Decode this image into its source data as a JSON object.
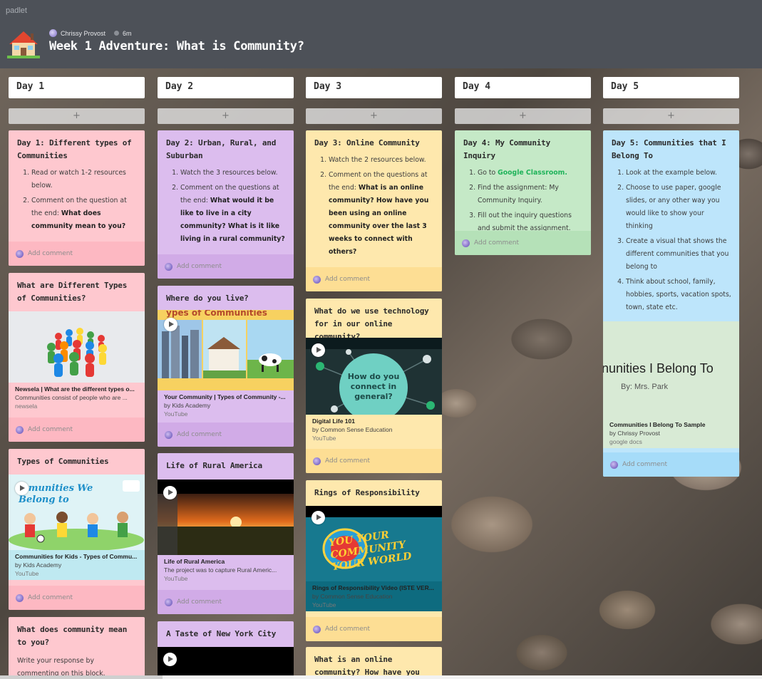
{
  "app": {
    "brand": "padlet"
  },
  "header": {
    "author": "Chrissy Provost",
    "time": "6m",
    "title": "Week 1 Adventure: What is Community?"
  },
  "add_symbol": "+",
  "comment_label": "Add comment",
  "columns": [
    {
      "label": "Day 1",
      "cards": [
        {
          "title": "Day 1: Different types of Communities",
          "items": [
            "Read or watch 1-2 resources below.",
            "Comment on the question at the end: ",
            "What does community mean to you?"
          ]
        },
        {
          "title": "What are Different Types of Communities?",
          "attachment": {
            "title": "Newsela | What are the different types o...",
            "desc": "Communities consist of people who are ...",
            "source": "newsela"
          }
        },
        {
          "title": "Types of Communities",
          "attachment": {
            "title": "Communities for Kids - Types of Commu...",
            "by": "by Kids Academy",
            "source": "YouTube",
            "thumb_text": "mmunities We Belong to"
          }
        },
        {
          "title": "What does community mean to you?",
          "body": "Write your response by commenting on this block."
        }
      ]
    },
    {
      "label": "Day 2",
      "cards": [
        {
          "title": "Day 2: Urban, Rural, and Suburban",
          "items": [
            "Watch the 3 resources below.",
            "Comment on the questions at the end: ",
            "What would it be like to live in a city community? What is it like living in a rural community?"
          ]
        },
        {
          "title": "Where do you live?",
          "attachment": {
            "title": "Your Community | Types of Community -...",
            "by": "by Kids Academy",
            "source": "YouTube",
            "thumb_text": "ypes of Communities"
          }
        },
        {
          "title": "Life of Rural America",
          "attachment": {
            "title": "Life of Rural America",
            "desc": "The project was to capture Rural Americ...",
            "source": "YouTube"
          }
        },
        {
          "title": "A Taste of New York City"
        }
      ]
    },
    {
      "label": "Day 3",
      "cards": [
        {
          "title": "Day 3: Online Community",
          "items": [
            "Watch the 2 resources below.",
            "Comment on the questions at the end: ",
            "What is an online community? How have you been using an online community over the last 3 weeks to connect with others?"
          ]
        },
        {
          "title": "What do we use technology for in our online community?",
          "attachment": {
            "title": "Digital Life 101",
            "by": "by Common Sense Education",
            "source": "YouTube",
            "thumb_text": "How do you connect in general?"
          }
        },
        {
          "title": "Rings of Responsibility",
          "attachment": {
            "title": "Rings of Responsibility Video (ISTE VER...",
            "by": "by Common Sense Education",
            "source": "YouTube",
            "thumb_text": "YOU YOUR COMMUNITY YOUR WORLD"
          }
        },
        {
          "title": "What is an online community? How have you"
        }
      ]
    },
    {
      "label": "Day 4",
      "cards": [
        {
          "title": "Day 4: My Community Inquiry",
          "items": [
            "Go to ",
            "Google Classroom.",
            "Find the assignment: My Community Inquiry.",
            "Fill out the inquiry questions and submit the assignment."
          ]
        }
      ]
    },
    {
      "label": "Day 5",
      "cards": [
        {
          "title": "Day 5: Communities that I Belong To",
          "items": [
            "Look at the example below.",
            "Choose to use paper, google slides, or any other way you would like to show your thinking",
            "Create a visual that shows the different communities that you belong to",
            "Think about school, family, hobbies, sports, vacation spots, town, state etc."
          ],
          "attachment": {
            "title": "Communities I Belong To Sample",
            "by": "by Chrissy Provost",
            "source": "google docs",
            "thumb_text": "nunities I Belong To",
            "thumb_sub": "By: Mrs. Park"
          }
        }
      ]
    }
  ],
  "colors": {
    "pink": "#fec8cf",
    "purple": "#dcbdee",
    "yellow": "#fee8ad",
    "green": "#c5e9c7",
    "blue": "#bde5fb"
  }
}
